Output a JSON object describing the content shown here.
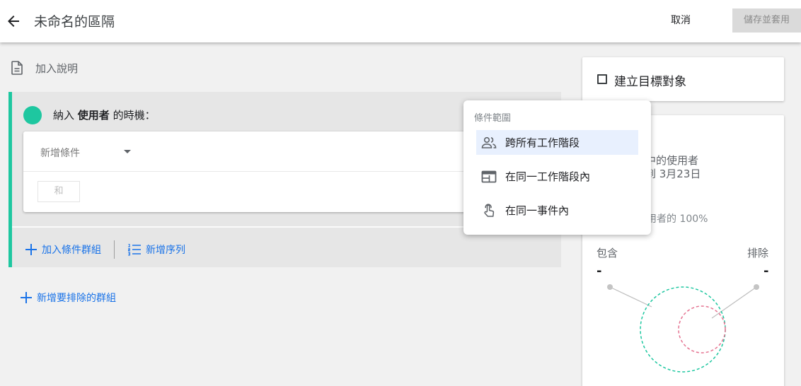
{
  "header": {
    "title": "未命名的區隔",
    "cancel_label": "取消",
    "save_label": "儲存並套用"
  },
  "description": {
    "label": "加入說明"
  },
  "group": {
    "heading_prefix": "納入",
    "heading_bold": "使用者",
    "heading_suffix": "的時機：",
    "add_condition_placeholder": "新增條件",
    "and_label": "和",
    "add_condition_group_label": "加入條件群組",
    "add_sequence_label": "新增序列"
  },
  "add_exclude_group_label": "新增要排除的群組",
  "audience": {
    "label": "建立目標對象"
  },
  "summary": {
    "line1_partial": "中的使用者",
    "line2_partial": "到 3月23日",
    "line3_partial": "用者的 100%",
    "include_label": "包含",
    "exclude_label": "排除",
    "include_value": "-",
    "exclude_value": "-"
  },
  "scope_menu": {
    "title": "條件範圍",
    "items": [
      {
        "label": "跨所有工作階段",
        "icon": "people-icon",
        "selected": true
      },
      {
        "label": "在同一工作階段內",
        "icon": "session-window-icon",
        "selected": false
      },
      {
        "label": "在同一事件內",
        "icon": "touch-icon",
        "selected": false
      }
    ]
  },
  "colors": {
    "accent": "#1ec7a0",
    "link": "#1a73e8",
    "include_circle": "#1ec7a0",
    "exclude_circle": "#e57391"
  }
}
